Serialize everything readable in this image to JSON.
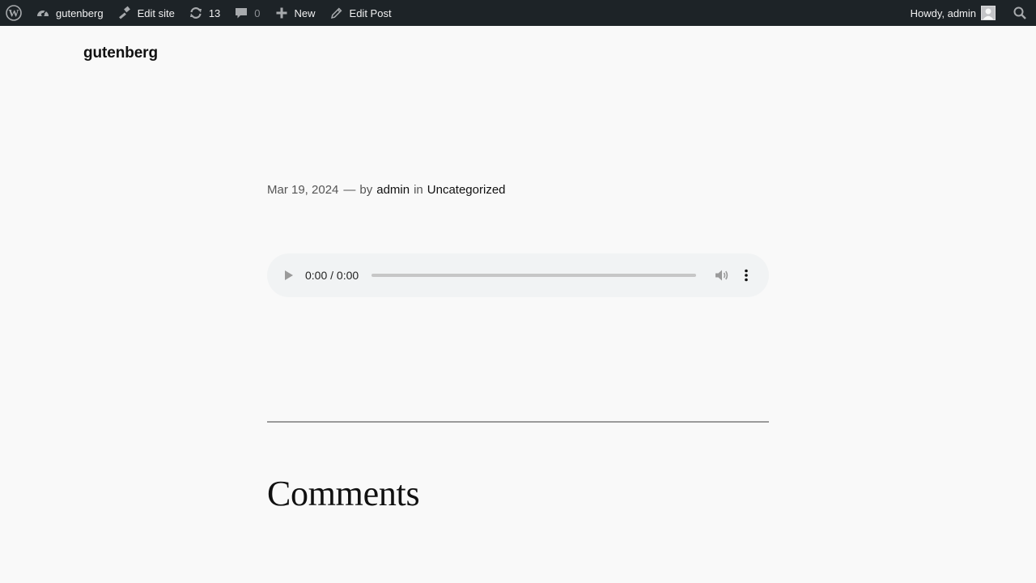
{
  "admin_bar": {
    "wp_logo_icon": "wordpress-logo-icon",
    "site_name": "gutenberg",
    "edit_site": "Edit site",
    "updates_count": "13",
    "comments_count": "0",
    "new_label": "New",
    "edit_post": "Edit Post",
    "howdy": "Howdy, admin",
    "colors": {
      "background": "#1d2327",
      "text": "#f0f0f1",
      "icon": "#a7aaad"
    }
  },
  "site": {
    "title": "gutenberg"
  },
  "post": {
    "date": "Mar 19, 2024",
    "dash": "—",
    "by": "by",
    "author": "admin",
    "in": "in",
    "category": "Uncategorized"
  },
  "audio": {
    "time": "0:00 / 0:00",
    "progress": 0
  },
  "comments": {
    "heading": "Comments"
  }
}
